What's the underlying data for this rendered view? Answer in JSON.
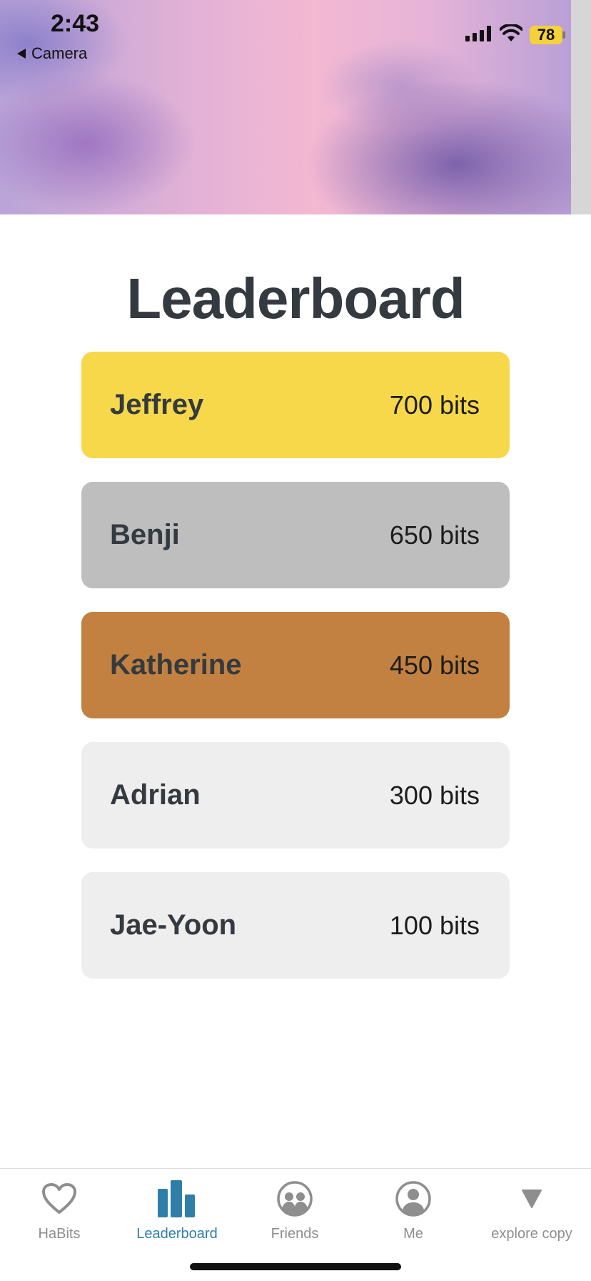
{
  "status_bar": {
    "time": "2:43",
    "back_label": "Camera",
    "battery": "78"
  },
  "page": {
    "title": "Leaderboard"
  },
  "leaderboard": [
    {
      "name": "Jeffrey",
      "score": "700 bits",
      "color": "#f7d84b"
    },
    {
      "name": "Benji",
      "score": "650 bits",
      "color": "#bebebe"
    },
    {
      "name": "Katherine",
      "score": "450 bits",
      "color": "#c28140"
    },
    {
      "name": "Adrian",
      "score": "300 bits",
      "color": "#eeeeee"
    },
    {
      "name": "Jae-Yoon",
      "score": "100 bits",
      "color": "#eeeeee"
    }
  ],
  "tabs": [
    {
      "label": "HaBits",
      "icon": "heart-icon",
      "active": false
    },
    {
      "label": "Leaderboard",
      "icon": "bar-chart-icon",
      "active": true
    },
    {
      "label": "Friends",
      "icon": "friends-icon",
      "active": false
    },
    {
      "label": "Me",
      "icon": "user-circle-icon",
      "active": false
    },
    {
      "label": "explore copy",
      "icon": "triangle-down-icon",
      "active": false
    }
  ],
  "colors": {
    "accent": "#2f7ea8",
    "inactive_tab": "#8e8e8e",
    "title_text": "#343a40"
  }
}
